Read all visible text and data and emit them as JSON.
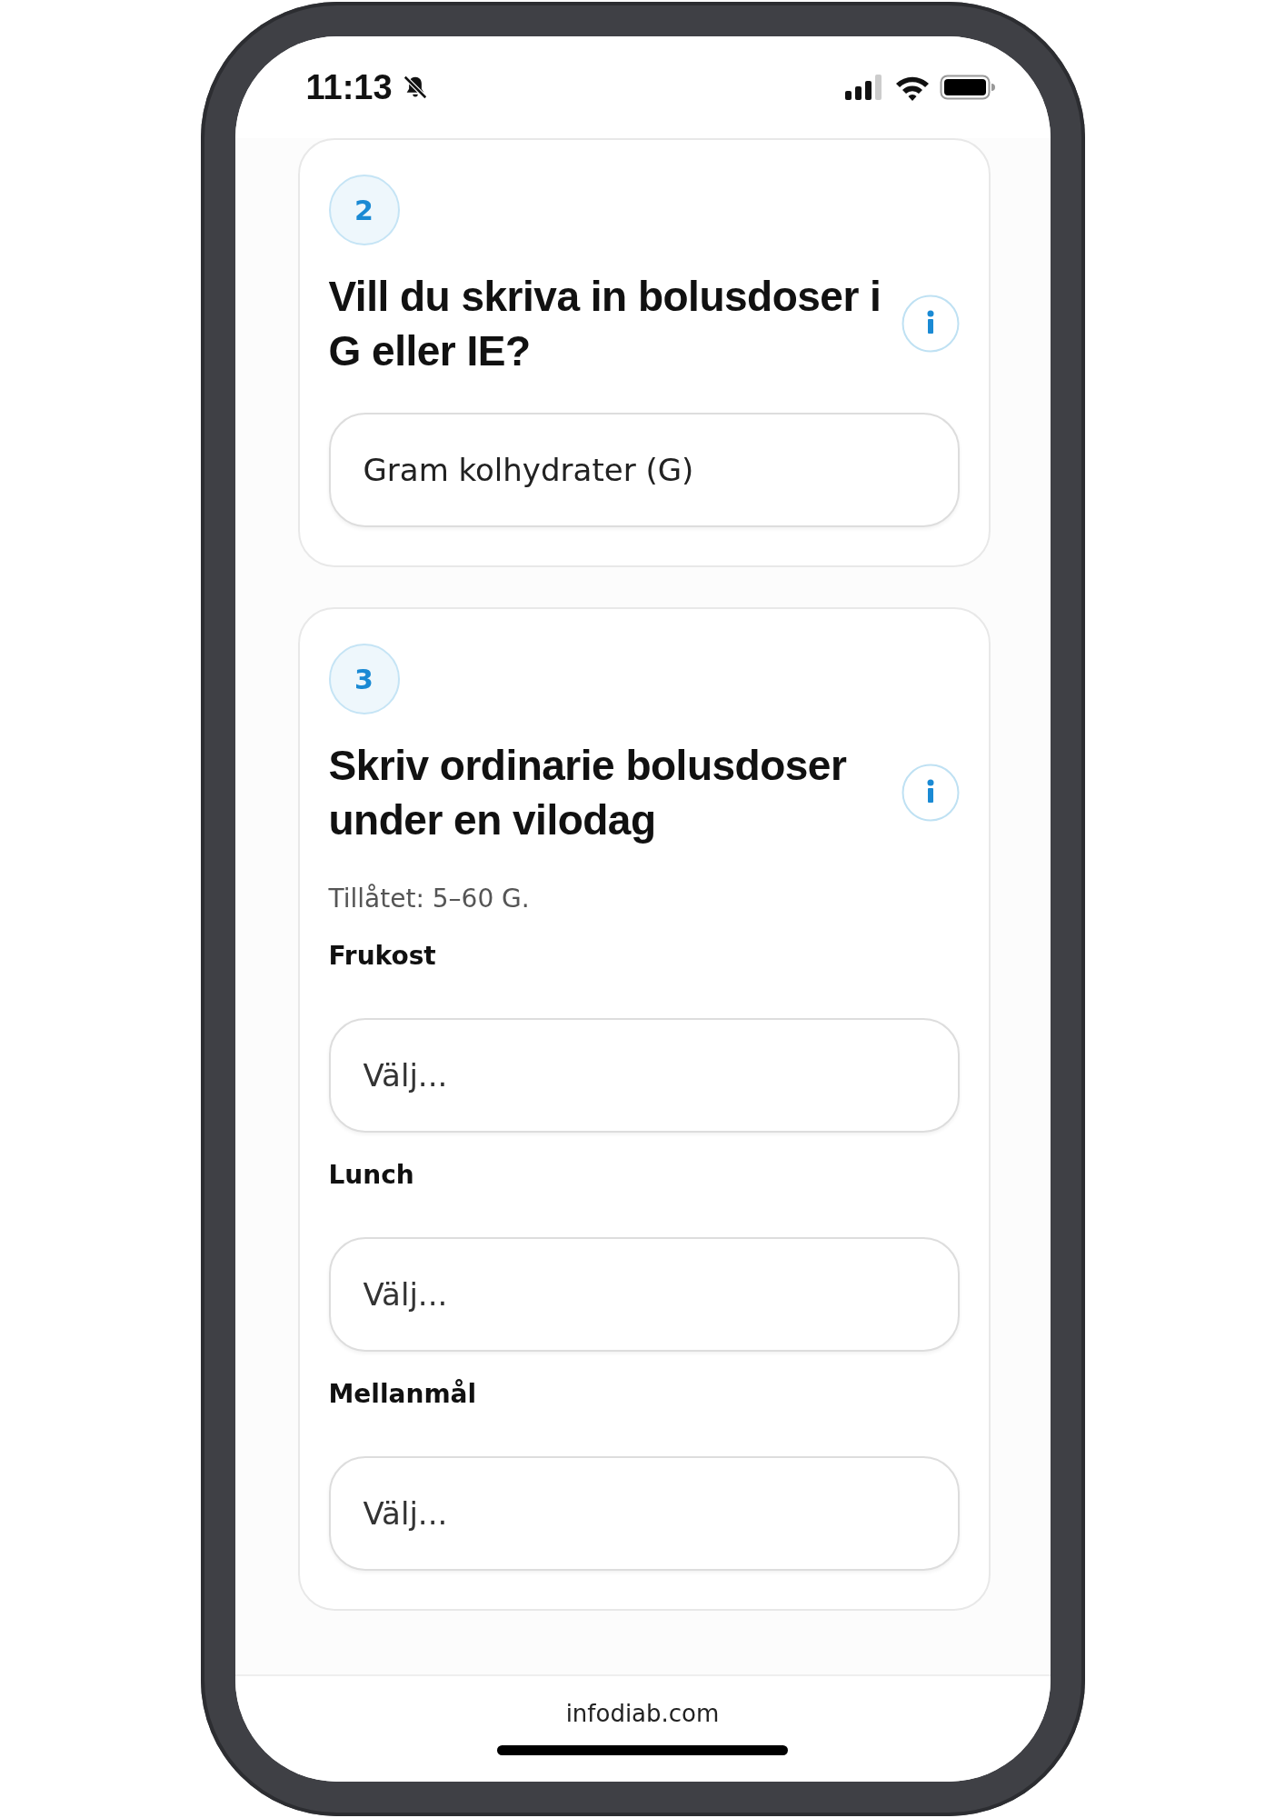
{
  "status_bar": {
    "time": "11:13",
    "muted": true
  },
  "cards": [
    {
      "number": "2",
      "title": "Vill du skriva in bolusdoser i G eller IE?",
      "fields": [
        {
          "value": "Gram kolhydrater (G)"
        }
      ]
    },
    {
      "number": "3",
      "title": "Skriv ordinarie bolusdoser under en vilodag",
      "hint": "Tillåtet: 5–60 G.",
      "fields": [
        {
          "label": "Frukost",
          "placeholder": "Välj..."
        },
        {
          "label": "Lunch",
          "placeholder": "Välj..."
        },
        {
          "label": "Mellanmål",
          "placeholder": "Välj..."
        }
      ]
    }
  ],
  "footer": {
    "domain": "infodiab.com"
  }
}
